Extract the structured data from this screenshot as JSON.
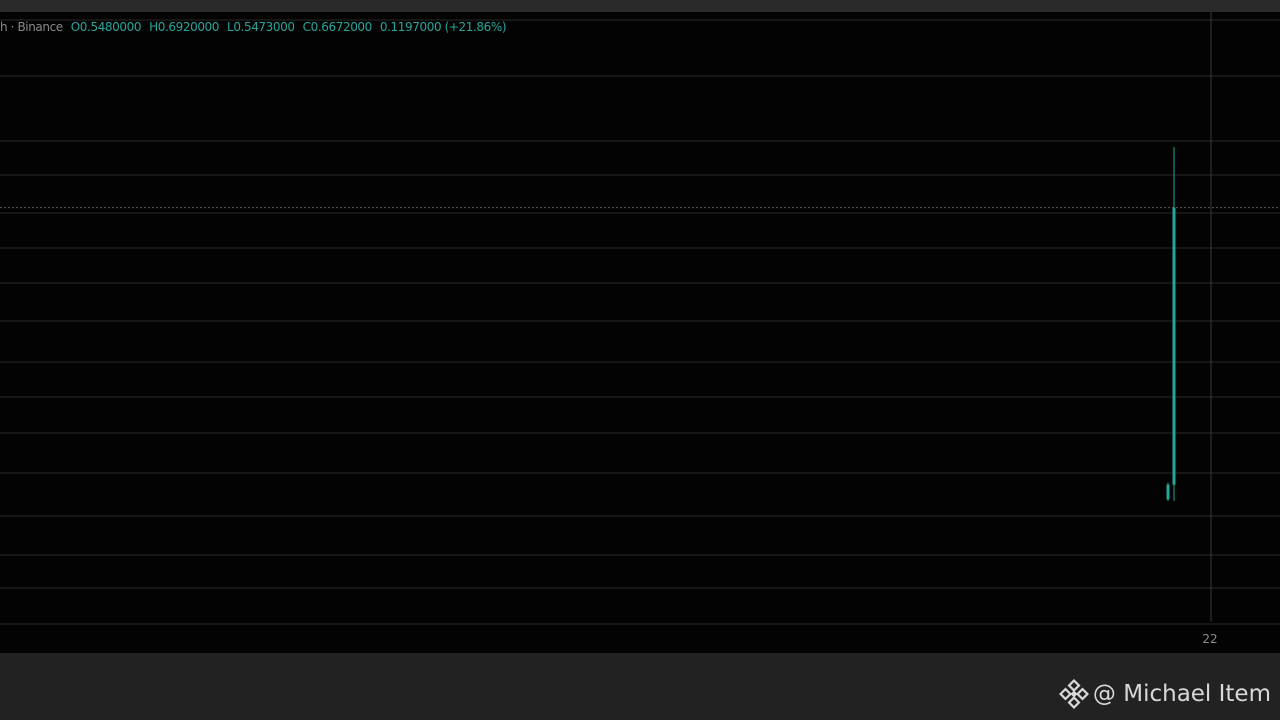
{
  "legend": {
    "source": "h · Binance",
    "open": "O0.5480000",
    "high": "H0.6920000",
    "low": "L0.5473000",
    "close": "C0.6672000",
    "change": "0.1197000 (+21.86%)"
  },
  "colors": {
    "background": "#030303",
    "grid": "#2a2a2a",
    "up": "#26a69a",
    "text_muted": "#8a8a8a",
    "footer": "#222222"
  },
  "chart_data": {
    "type": "candlestick",
    "x_tick_labels": [
      "22"
    ],
    "current_price_line": 0.6672,
    "candles": [
      {
        "open": 0.548,
        "high": 0.5548,
        "low": 0.5473,
        "close": 0.554
      },
      {
        "open": 0.554,
        "high": 0.692,
        "low": 0.5473,
        "close": 0.6672
      }
    ]
  },
  "watermark": {
    "logo_icon": "binance-logo-icon",
    "text": "@ Michael Item"
  }
}
